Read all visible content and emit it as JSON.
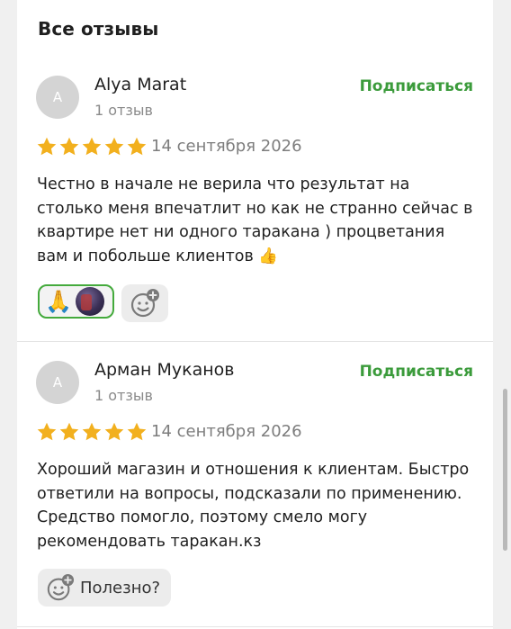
{
  "section_title": "Все отзывы",
  "reviews": [
    {
      "avatar_letter": "A",
      "author": "Alya Marat",
      "count": "1 отзыв",
      "subscribe_label": "Подписаться",
      "rating": 5,
      "date": "14 сентября 2026",
      "text": "Честно в начале не верила что результат на столько меня впечатлит но как не странно сейчас в квартире нет ни одного таракана ) процветания вам и побольше клиентов 👍",
      "reaction_emoji": "🙏"
    },
    {
      "avatar_letter": "A",
      "author": "Арман Муканов",
      "count": "1 отзыв",
      "subscribe_label": "Подписаться",
      "rating": 5,
      "date": "14 сентября 2026",
      "text": "Хороший магазин и отношения к клиентам. Быстро ответили на вопросы, подсказали по применению. Средство помогло, поэтому смело могу рекомендовать таракан.кз",
      "useful_label": "Полезно?"
    }
  ],
  "colors": {
    "accent_green": "#3b9b3b",
    "star_gold": "#f2b01e",
    "avatar_gray": "#d4d4d4"
  }
}
